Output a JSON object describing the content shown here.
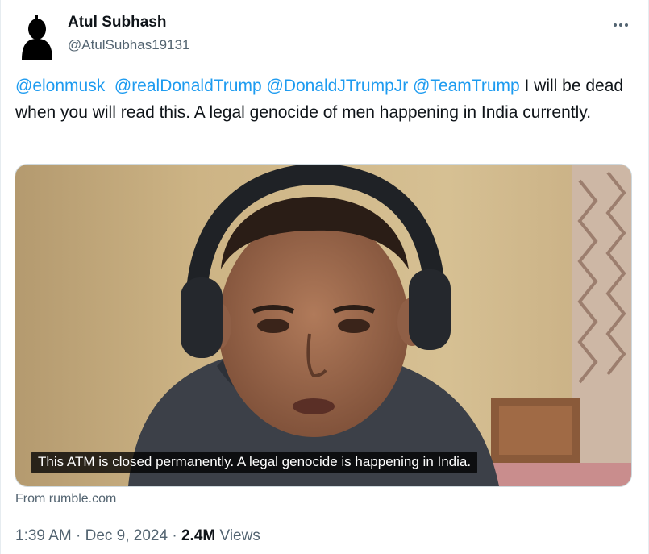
{
  "author": {
    "name": "Atul Subhash",
    "handle": "@AtulSubhas19131",
    "avatar_icon": "silhouette-avatar"
  },
  "menu": {
    "more_icon": "more-options-icon"
  },
  "tweet": {
    "mentions": [
      "@elonmusk",
      "@realDonaldTrump",
      "@DonaldJTrumpJr",
      "@TeamTrump"
    ],
    "text": " I will be dead when you will read this. A legal genocide of men happening in India currently."
  },
  "media": {
    "caption": "This ATM is closed permanently. A legal genocide is happening in India.",
    "source": "From rumble.com"
  },
  "meta": {
    "time": "1:39 AM",
    "separator": "·",
    "date": "Dec 9, 2024",
    "views_count": "2.4M",
    "views_label": "Views"
  },
  "colors": {
    "link": "#1d9bf0",
    "text": "#0f1419",
    "secondary": "#536471"
  }
}
